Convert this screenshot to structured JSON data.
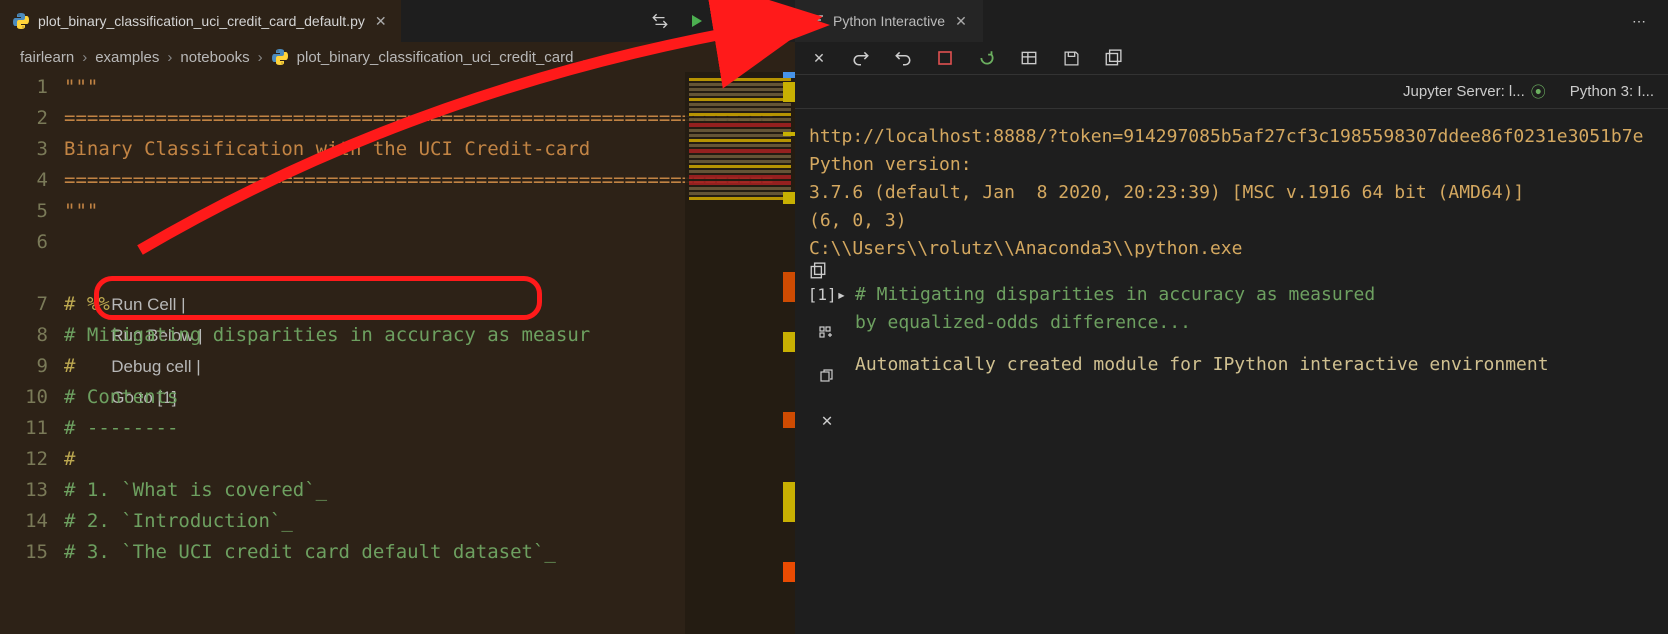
{
  "editor": {
    "tab": {
      "filename": "plot_binary_classification_uci_credit_card_default.py"
    },
    "actions": {
      "compare": "compare",
      "run": "run",
      "split": "split",
      "more": "more"
    },
    "breadcrumb": {
      "seg1": "fairlearn",
      "seg2": "examples",
      "seg3": "notebooks",
      "seg4": "plot_binary_classification_uci_credit_card_..."
    },
    "gutter": [
      "1",
      "2",
      "3",
      "4",
      "5",
      "6",
      "",
      "7",
      "8",
      "9",
      "10",
      "11",
      "12",
      "13",
      "14",
      "15"
    ],
    "lines": {
      "l1": "\"\"\"",
      "l2": "==============================================================",
      "l3": "Binary Classification with the UCI Credit-card",
      "l4": "==============================================================",
      "l5": "\"\"\"",
      "l6": "",
      "codelens_runcell": "Run Cell",
      "codelens_runbelow": "Run Below",
      "codelens_debug": "Debug cell",
      "codelens_goto": "Go to [1]",
      "l7": "# %%",
      "l8": "# Mitigating disparities in accuracy as measur",
      "l9": "#",
      "l10": "# Contents",
      "l11": "# --------",
      "l12": "#",
      "l13": "# 1. `What is covered`_",
      "l14": "# 2. `Introduction`_",
      "l15": "# 3. `The UCI credit card default dataset`_"
    }
  },
  "interactive": {
    "tab": {
      "title": "Python Interactive"
    },
    "toolbar": {
      "close": "close",
      "redo": "redo",
      "undo": "undo",
      "stop": "stop",
      "restart": "restart",
      "variables": "variables",
      "save": "save",
      "export": "export"
    },
    "server": {
      "jupyter": "Jupyter Server: l...",
      "python": "Python 3: I..."
    },
    "output": {
      "line1": "http://localhost:8888/?token=914297085b5af27cf3c1985598307ddee86f0231e3051b7e",
      "line2": "Python version:",
      "line3": "3.7.6 (default, Jan  8 2020, 20:23:39) [MSC v.1916 64 bit (AMD64)]",
      "line4": "(6, 0, 3)",
      "line5": "C:\\\\Users\\\\rolutz\\\\Anaconda3\\\\python.exe"
    },
    "cell": {
      "num": "[1]",
      "comment1": "# Mitigating disparities in accuracy as measured",
      "comment2": "  by equalized-odds difference...",
      "info": "Automatically created module for IPython interactive environment"
    }
  }
}
